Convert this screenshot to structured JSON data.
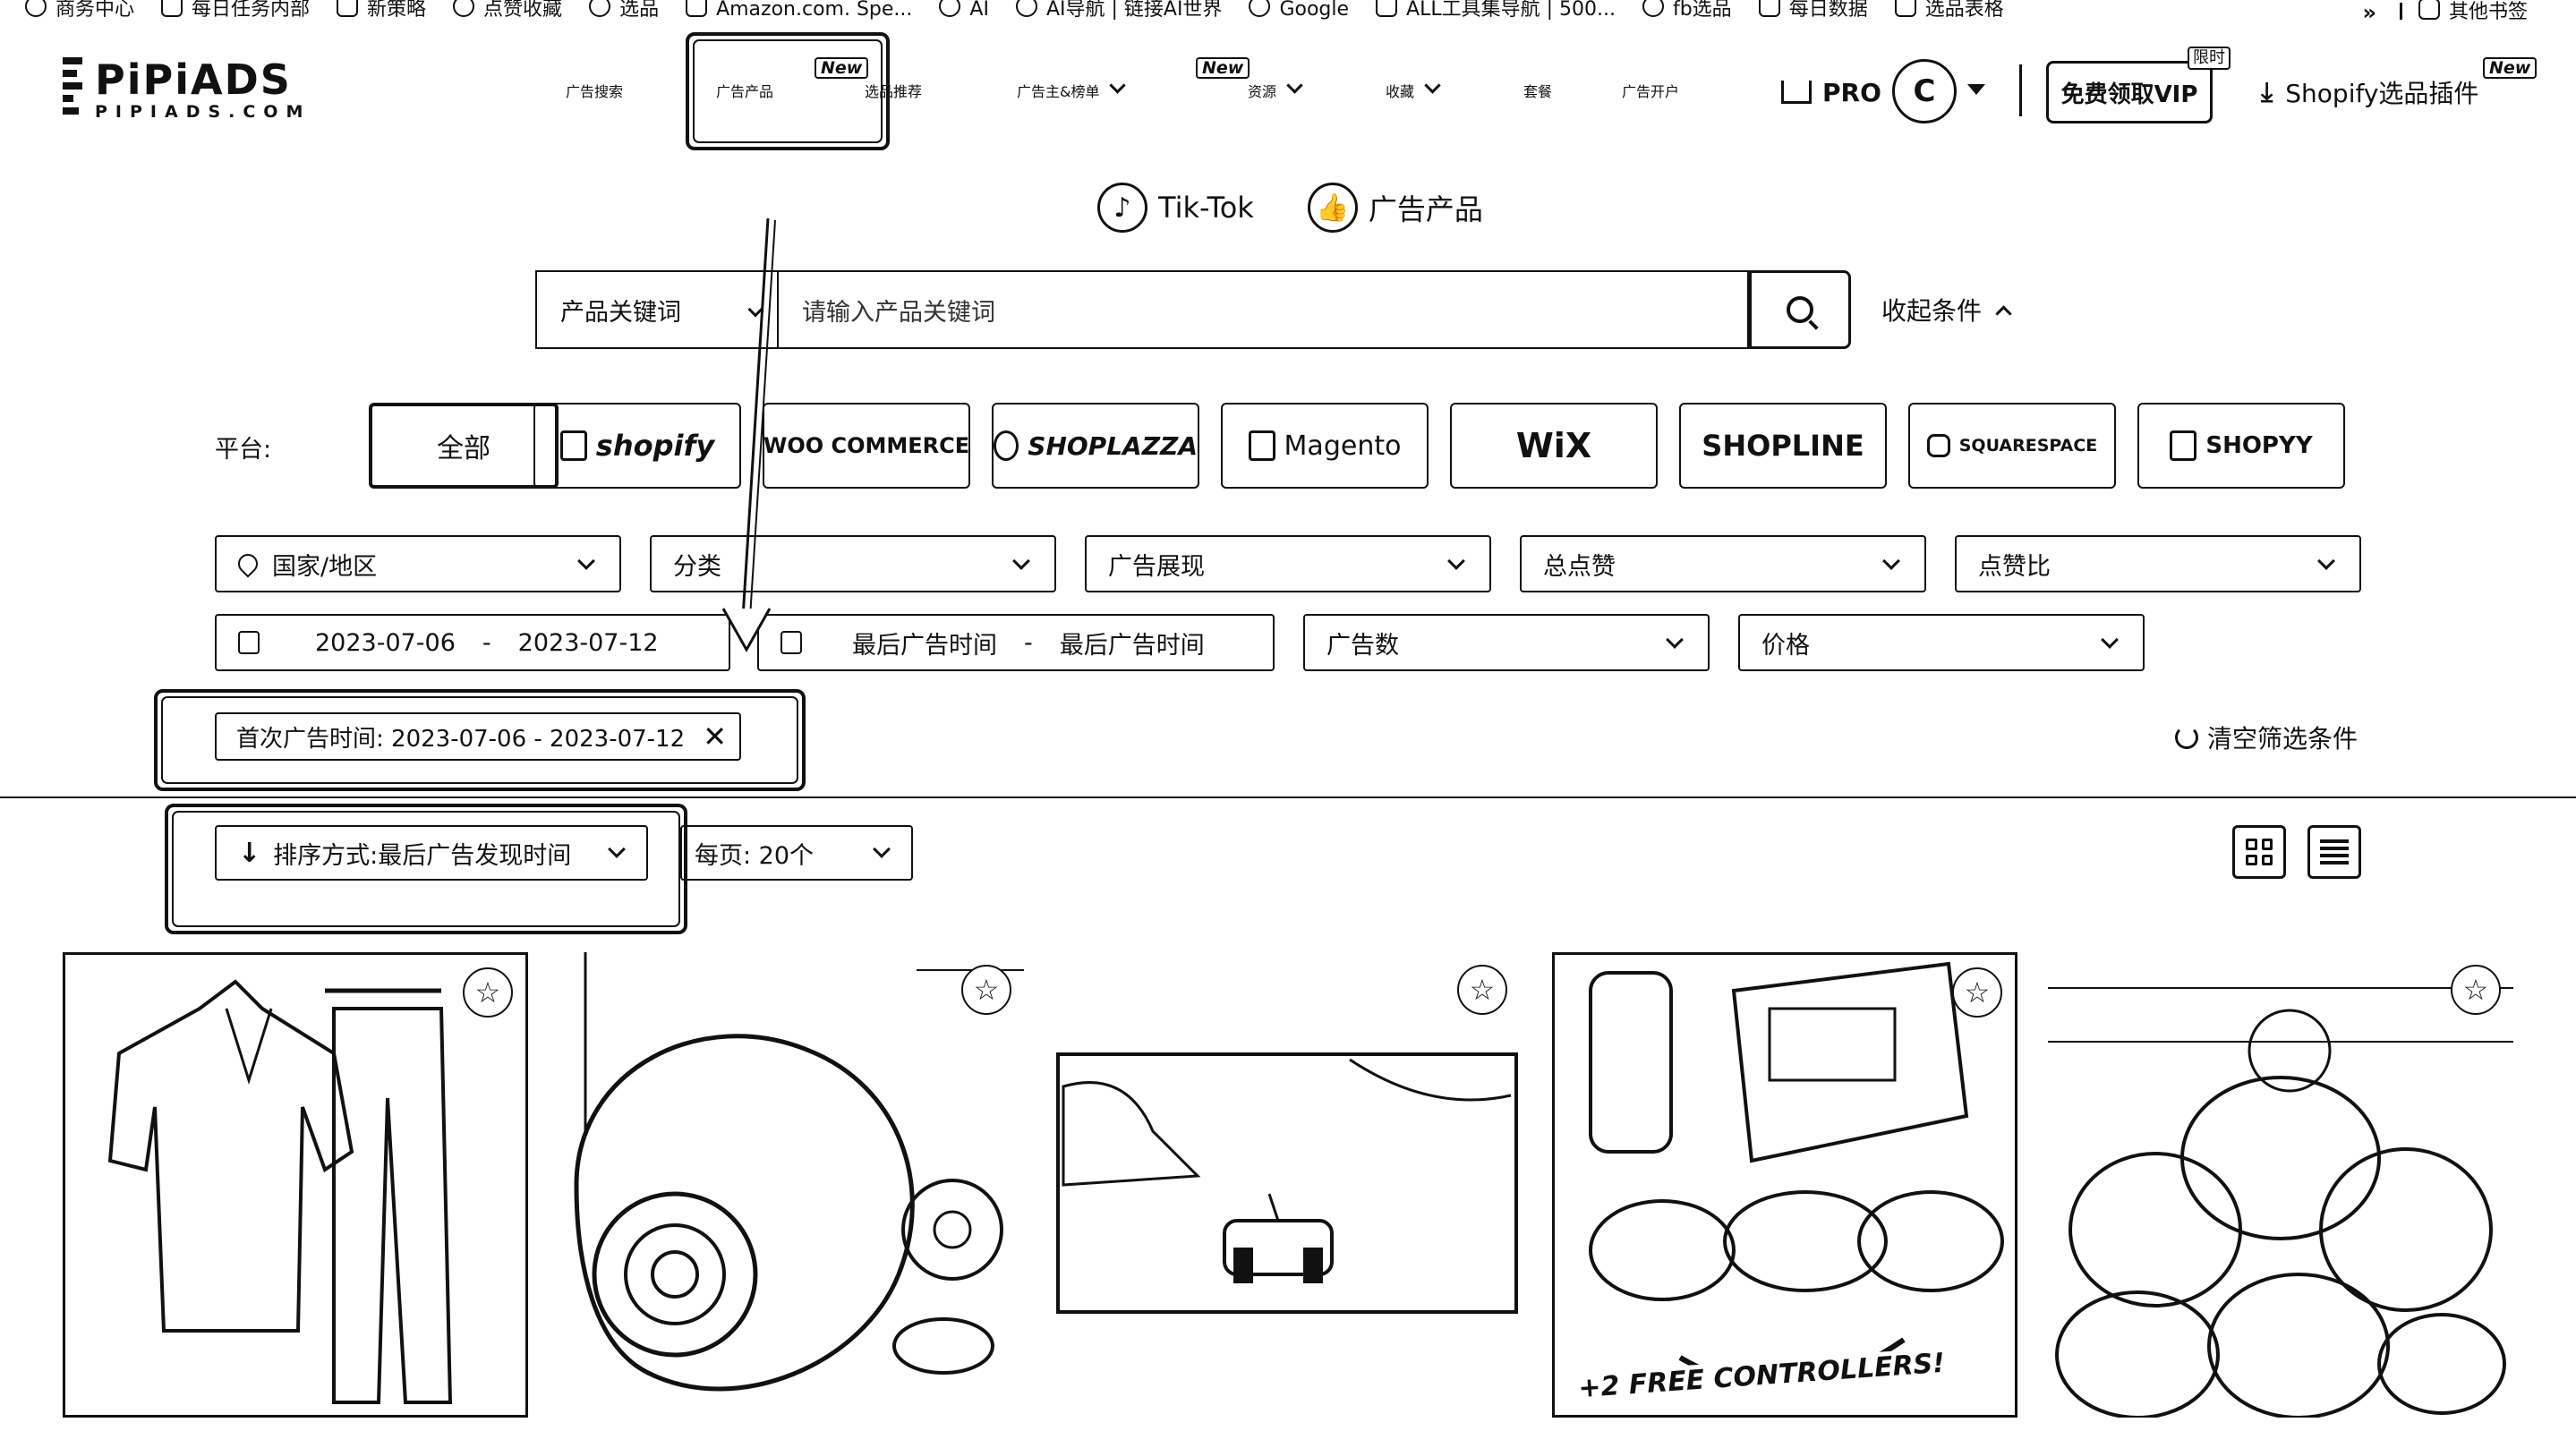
{
  "bookmarks": [
    {
      "label": "商务中心",
      "icon": "tiktok-icon"
    },
    {
      "label": "每日任务内部",
      "icon": "doc-icon"
    },
    {
      "label": "新策略",
      "icon": "pro-icon"
    },
    {
      "label": "点赞收藏",
      "icon": "tiktok-icon"
    },
    {
      "label": "选品",
      "icon": "tiktok-icon"
    },
    {
      "label": "Amazon.com. Spe...",
      "icon": "amazon-icon"
    },
    {
      "label": "AI",
      "icon": "ai-icon"
    },
    {
      "label": "AI导航 | 链接AI世界",
      "icon": "ai-nav-icon"
    },
    {
      "label": "Google",
      "icon": "google-icon"
    },
    {
      "label": "ALL工具集导航 | 500...",
      "icon": "tools-icon"
    },
    {
      "label": "fb选品",
      "icon": "meta-icon"
    },
    {
      "label": "每日数据",
      "icon": "doc-icon"
    },
    {
      "label": "选品表格",
      "icon": "doc-icon"
    }
  ],
  "bookmarks_more": "»",
  "bookmarks_other": "其他书签",
  "logo": {
    "main": "PiPiADS",
    "sub": "PIPIADS.COM"
  },
  "nav": [
    {
      "label": "广告搜索",
      "has_caret": false,
      "new": false
    },
    {
      "label": "广告产品",
      "has_caret": false,
      "new": true
    },
    {
      "label": "选品推荐",
      "has_caret": false,
      "new": false
    },
    {
      "label": "广告主&榜单",
      "has_caret": true,
      "new": true
    },
    {
      "label": "资源",
      "has_caret": true,
      "new": false
    },
    {
      "label": "收藏",
      "has_caret": true,
      "new": false
    },
    {
      "label": "套餐",
      "has_caret": false,
      "new": false
    },
    {
      "label": "广告开户",
      "has_caret": false,
      "new": false
    }
  ],
  "new_badge": "New",
  "pro_label": "PRO",
  "coin_label": "C",
  "vip_button": "免费领取VIP",
  "vip_tag": "限时",
  "plugin_label": "Shopify选品插件",
  "subtabs": [
    {
      "label": "Tik-Tok",
      "icon": "tiktok-icon"
    },
    {
      "label": "广告产品",
      "icon": "thumbs-up-icon"
    }
  ],
  "search": {
    "select_value": "产品关键词",
    "placeholder": "请输入产品关键词",
    "collapse_label": "收起条件"
  },
  "platform": {
    "label": "平台:",
    "options": [
      "全部",
      "shopify",
      "WOO COMMERCE",
      "SHOPLAZZA",
      "Magento",
      "WiX",
      "SHOPLINE",
      "SQUARESPACE",
      "SHOPYY"
    ],
    "selected": "全部"
  },
  "filters_row1": [
    "国家/地区",
    "分类",
    "广告展现",
    "总点赞",
    "点赞比"
  ],
  "date_range_1": {
    "start": "2023-07-06",
    "end": "2023-07-12",
    "sep": "-"
  },
  "date_range_2": {
    "start": "最后广告时间",
    "end": "最后广告时间",
    "sep": "-"
  },
  "filters_row2": [
    "广告数",
    "价格"
  ],
  "active_tag": "首次广告时间: 2023-07-06 - 2023-07-12",
  "active_tag_close": "✕",
  "clear_filters": "清空筛选条件",
  "sort": {
    "label": "排序方式:最后广告发现时间",
    "per_page": "每页: 20个"
  },
  "products": [
    {
      "name": "product-card-clothing-set"
    },
    {
      "name": "product-card-security-camera"
    },
    {
      "name": "product-card-rc-car"
    },
    {
      "name": "product-card-nostalgia-stick",
      "caption": "+2 FREE CONTROLLERS!"
    },
    {
      "name": "product-card-plush-toys"
    }
  ]
}
